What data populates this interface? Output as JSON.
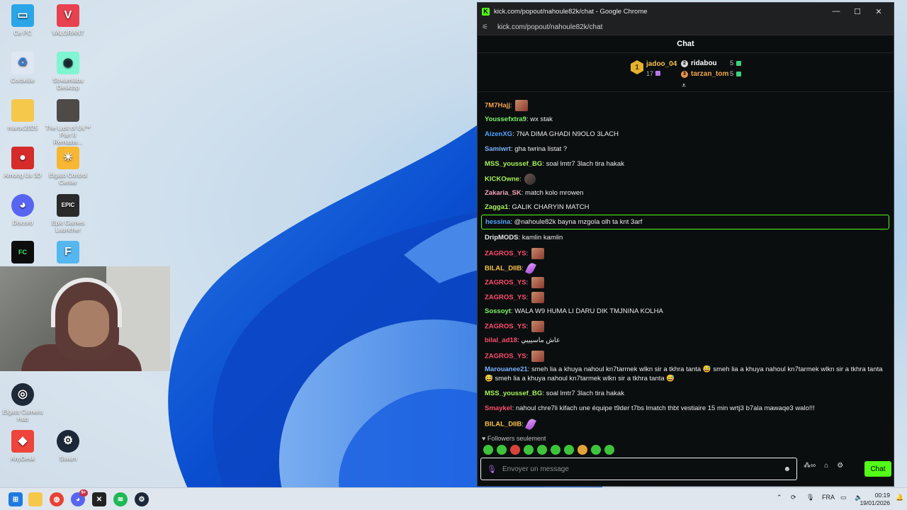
{
  "desktop": {
    "icons": [
      {
        "label": "Ce PC"
      },
      {
        "label": "VALORANT"
      },
      {
        "label": "Corbeille"
      },
      {
        "label": "Streamlabs Desktop"
      },
      {
        "label": "maroc2025"
      },
      {
        "label": "The Last of Us™ Part II Remaste..."
      },
      {
        "label": "Among Us 3D"
      },
      {
        "label": "Elgato Control Center"
      },
      {
        "label": "Discord"
      },
      {
        "label": "Epic Games Launcher"
      },
      {
        "label": "Elgato Camera Hub"
      },
      {
        "label": "AnyDesk"
      },
      {
        "label": "Steam"
      }
    ]
  },
  "window": {
    "title": "kick.com/popout/nahoule82k/chat - Google Chrome",
    "url": "kick.com/popout/nahoule82k/chat",
    "minimize": "—",
    "maximize": "☐",
    "close": "✕"
  },
  "chat": {
    "header": "Chat",
    "leaderboard": {
      "first": {
        "rank": "1",
        "name": "jadoo_04",
        "count": "17"
      },
      "second": {
        "name": "ridabou",
        "count": "5"
      },
      "third": {
        "name": "tarzan_tom",
        "count": "5"
      },
      "expand_icon": "⩡"
    },
    "messages": [
      {
        "user": "7M7Hajj",
        "color": "#f6a34c",
        "text": "",
        "emote": "emote"
      },
      {
        "user": "Youssefxtra9",
        "color": "#7cf569",
        "text": "wx stak"
      },
      {
        "user": "AizenXG",
        "color": "#4fa4ff",
        "text": "7NA DIMA GHADI N9OLO 3LACH"
      },
      {
        "user": "Samiwrt",
        "color": "#7ab3ff",
        "text": "gha twrina listat ?"
      },
      {
        "user": "MSS_youssef_BG",
        "color": "#a6f25a",
        "text": "soal lmtr7 3lach tira hakak"
      },
      {
        "user": "KICKOwne",
        "color": "#a6f25a",
        "text": "",
        "emote": "face"
      },
      {
        "user": "Zakaria_SK",
        "color": "#f3a3b8",
        "text": "match kolo mrowen"
      },
      {
        "user": "Zagga1",
        "color": "#a6f25a",
        "text": "GALIK CHARYIN MATCH"
      },
      {
        "user": "hessina",
        "color": "#4fa4ff",
        "text": "@nahoule82k bayna mzgola olh ta knt 3arf",
        "highlight": true
      },
      {
        "user": "DripMODS",
        "color": "#e6e6e6",
        "text": "kamlin kamlin"
      },
      {
        "user": "ZAGROS_YS",
        "color": "#ff4d6d",
        "text": "",
        "emote": "emote"
      },
      {
        "user": "BILAL_DIIB",
        "color": "#f6c14c",
        "text": "",
        "emote": "feather"
      },
      {
        "user": "ZAGROS_YS",
        "color": "#ff4d6d",
        "text": "",
        "emote": "emote"
      },
      {
        "user": "ZAGROS_YS",
        "color": "#ff4d6d",
        "text": "",
        "emote": "emote"
      },
      {
        "user": "Sossoyt",
        "color": "#7cf569",
        "text": "WALA W9 HUMA LI DARU DIK TMJNINA KOLHA"
      },
      {
        "user": "ZAGROS_YS",
        "color": "#ff4d6d",
        "text": "",
        "emote": "emote"
      },
      {
        "user": "bilal_ad18",
        "color": "#ff4d6d",
        "text": "عاش ماسيييي"
      },
      {
        "user": "ZAGROS_YS",
        "color": "#ff4d6d",
        "text": "",
        "emote": "emote"
      },
      {
        "user": "Marouanee21",
        "color": "#7ab3ff",
        "text": "smeh lia a khuya nahoul kn7tarmek wlkn sir a tkhra tanta 😅 smeh lia a khuya nahoul kn7tarmek wlkn sir a tkhra tanta 😅 smeh lia a khuya nahoul kn7tarmek wlkn sir a tkhra tanta 😅"
      },
      {
        "user": "MSS_youssef_BG",
        "color": "#a6f25a",
        "text": "soal lmtr7 3lach tira hakak"
      },
      {
        "user": "Smaykel",
        "color": "#ff4d6d",
        "text": "nahoul chre7li kifach une équipe t9der t7bs lmatch thbt vestiaire 15 min wrtj3 b7ala mawaqe3 walo!!!"
      },
      {
        "user": "BILAL_DIIB",
        "color": "#f6c14c",
        "text": "",
        "emote": "feather"
      }
    ],
    "followers_label": "Followers seulement",
    "input_placeholder": "Envoyer un message",
    "send_label": "Chat",
    "accent": "#53fc18"
  },
  "taskbar": {
    "language": "FRA",
    "time": "00:19",
    "date": "19/01/2026",
    "badge": "9+"
  }
}
